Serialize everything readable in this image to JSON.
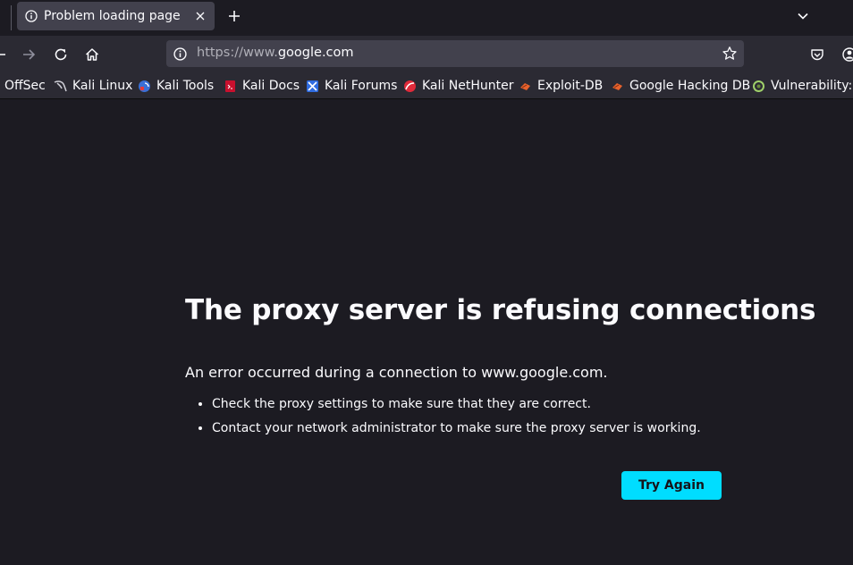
{
  "tab": {
    "title": "Problem loading page"
  },
  "urlbar": {
    "url_prefix": "https://www.",
    "url_domain": "google.com"
  },
  "bookmarks": [
    {
      "label": "OffSec",
      "icon": "offsec-icon"
    },
    {
      "label": "Kali Linux",
      "icon": "kali-dragon-icon"
    },
    {
      "label": "Kali Tools",
      "icon": "kali-tools-icon"
    },
    {
      "label": "Kali Docs",
      "icon": "kali-docs-icon"
    },
    {
      "label": "Kali Forums",
      "icon": "kali-forums-icon"
    },
    {
      "label": "Kali NetHunter",
      "icon": "nethunter-icon"
    },
    {
      "label": "Exploit-DB",
      "icon": "exploit-db-icon"
    },
    {
      "label": "Google Hacking DB",
      "icon": "ghdb-icon"
    },
    {
      "label": "Vulnerability: S",
      "icon": "vulnerability-icon"
    }
  ],
  "error": {
    "title": "The proxy server is refusing connections",
    "description": "An error occurred during a connection to www.google.com.",
    "suggestions": [
      "Check the proxy settings to make sure that they are correct.",
      "Contact your network administrator to make sure the proxy server is working."
    ],
    "button_label": "Try Again"
  },
  "colors": {
    "accent": "#00ddff",
    "background": "#1c1b22",
    "toolbar": "#2b2a33"
  }
}
